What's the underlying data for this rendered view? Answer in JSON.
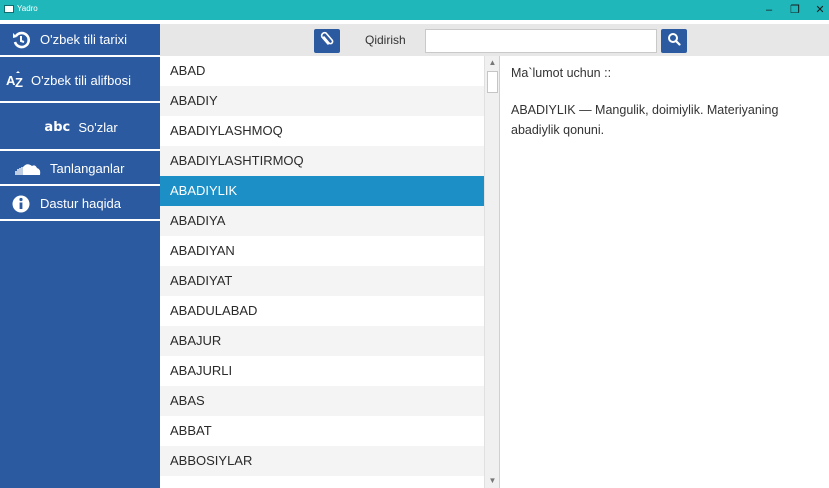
{
  "window": {
    "title": "Yadro",
    "minimize_glyph": "–",
    "maximize_glyph": "❐",
    "close_glyph": "✕"
  },
  "sidebar": {
    "items": [
      {
        "label": "O'zbek tili tarixi",
        "icon": "history-icon"
      },
      {
        "label": "O'zbek tili alifbosi",
        "icon": "alphabet-az-icon",
        "icon_text": "AZ"
      },
      {
        "label": "So'zlar",
        "icon": "abc-icon",
        "icon_text": "abc"
      },
      {
        "label": "Tanlanganlar",
        "icon": "cloud-icon"
      },
      {
        "label": "Dastur haqida",
        "icon": "info-icon"
      }
    ]
  },
  "toolbar": {
    "search_label": "Qidirish",
    "search_value": "",
    "search_placeholder": ""
  },
  "word_list": [
    "ABAD",
    "ABADIY",
    "ABADIYLASHMOQ",
    "ABADIYLASHTIRMOQ",
    "ABADIYLIK",
    "ABADIYA",
    "ABADIYAN",
    "ABADIYAT",
    "ABADULABAD",
    "ABAJUR",
    "ABAJURLI",
    "ABAS",
    "ABBAT",
    "ABBOSIYLAR"
  ],
  "selected_word": "ABADIYLIK",
  "detail": {
    "heading": "Ma`lumot uchun ::",
    "body": "ABADIYLIK — Mangulik, doimiylik. Materiyaning abadiylik qonuni."
  },
  "colors": {
    "titlebar": "#1fb7b9",
    "sidebar": "#2b5aa0",
    "selected_row": "#1c8fc7",
    "toolbar": "#e7e7e7"
  }
}
